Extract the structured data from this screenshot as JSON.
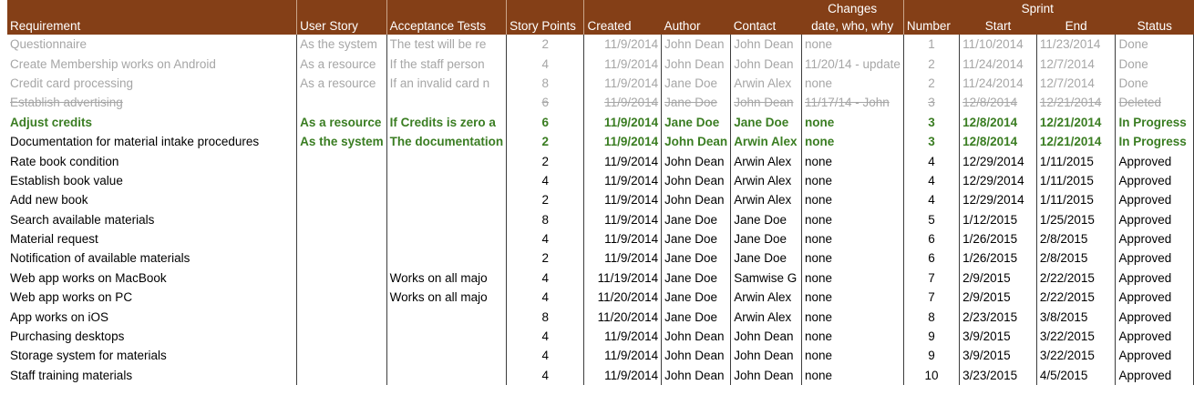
{
  "headers": {
    "requirement": "Requirement",
    "user_story": "User Story",
    "acceptance_tests": "Acceptance Tests",
    "story_points": "Story Points",
    "created": "Created",
    "author": "Author",
    "contact": "Contact",
    "changes_top": "Changes",
    "changes_bottom": "date, who, why",
    "sprint_group": "Sprint",
    "number": "Number",
    "start": "Start",
    "end": "End",
    "status": "Status"
  },
  "rows": [
    {
      "requirement": "Questionnaire",
      "user_story": "As the system",
      "acceptance_tests": "The test will be re",
      "points": "2",
      "created": "11/9/2014",
      "author": "John Dean",
      "contact": "John Dean",
      "changes": "none",
      "number": "1",
      "start": "11/10/2014",
      "end": "11/23/2014",
      "status": "Done",
      "state": "done"
    },
    {
      "requirement": "Create Membership works on Android",
      "user_story": "As a resource",
      "acceptance_tests": "If the staff person",
      "points": "4",
      "created": "11/9/2014",
      "author": "John Dean",
      "contact": "John Dean",
      "changes": "11/20/14 - update",
      "number": "2",
      "start": "11/24/2014",
      "end": "12/7/2014",
      "status": "Done",
      "state": "done"
    },
    {
      "requirement": "Credit card processing",
      "user_story": "As a resource",
      "acceptance_tests": "If an invalid card n",
      "points": "8",
      "created": "11/9/2014",
      "author": "Jane Doe",
      "contact": "Arwin Alex",
      "changes": "none",
      "number": "2",
      "start": "11/24/2014",
      "end": "12/7/2014",
      "status": "Done",
      "state": "done"
    },
    {
      "requirement": "Establish advertising",
      "user_story": "",
      "acceptance_tests": "",
      "points": "6",
      "created": "11/9/2014",
      "author": "Jane Doe",
      "contact": "John Dean",
      "changes": "11/17/14 - John",
      "number": "3",
      "start": "12/8/2014",
      "end": "12/21/2014",
      "status": "Deleted",
      "state": "deleted"
    },
    {
      "requirement": "Adjust credits",
      "user_story": "As a resource",
      "acceptance_tests": "If Credits is zero a",
      "points": "6",
      "created": "11/9/2014",
      "author": "Jane Doe",
      "contact": "Jane Doe",
      "changes": "none",
      "number": "3",
      "start": "12/8/2014",
      "end": "12/21/2014",
      "status": "In Progress",
      "state": "progress"
    },
    {
      "requirement": "Documentation for material intake procedures",
      "user_story": "As the system",
      "acceptance_tests": "The documentation",
      "points": "2",
      "created": "11/9/2014",
      "author": "John Dean",
      "contact": "Arwin Alex",
      "changes": "none",
      "number": "3",
      "start": "12/8/2014",
      "end": "12/21/2014",
      "status": "In Progress",
      "state": "progress2"
    },
    {
      "requirement": "Rate book condition",
      "user_story": "",
      "acceptance_tests": "",
      "points": "2",
      "created": "11/9/2014",
      "author": "John Dean",
      "contact": "Arwin Alex",
      "changes": "none",
      "number": "4",
      "start": "12/29/2014",
      "end": "1/11/2015",
      "status": "Approved",
      "state": "approved"
    },
    {
      "requirement": "Establish book value",
      "user_story": "",
      "acceptance_tests": "",
      "points": "4",
      "created": "11/9/2014",
      "author": "John Dean",
      "contact": "Arwin Alex",
      "changes": "none",
      "number": "4",
      "start": "12/29/2014",
      "end": "1/11/2015",
      "status": "Approved",
      "state": "approved"
    },
    {
      "requirement": "Add new book",
      "user_story": "",
      "acceptance_tests": "",
      "points": "2",
      "created": "11/9/2014",
      "author": "John Dean",
      "contact": "Arwin Alex",
      "changes": "none",
      "number": "4",
      "start": "12/29/2014",
      "end": "1/11/2015",
      "status": "Approved",
      "state": "approved"
    },
    {
      "requirement": "Search available materials",
      "user_story": "",
      "acceptance_tests": "",
      "points": "8",
      "created": "11/9/2014",
      "author": "Jane Doe",
      "contact": "Jane Doe",
      "changes": "none",
      "number": "5",
      "start": "1/12/2015",
      "end": "1/25/2015",
      "status": "Approved",
      "state": "approved"
    },
    {
      "requirement": "Material request",
      "user_story": "",
      "acceptance_tests": "",
      "points": "4",
      "created": "11/9/2014",
      "author": "Jane Doe",
      "contact": "Jane Doe",
      "changes": "none",
      "number": "6",
      "start": "1/26/2015",
      "end": "2/8/2015",
      "status": "Approved",
      "state": "approved"
    },
    {
      "requirement": "Notification of available materials",
      "user_story": "",
      "acceptance_tests": "",
      "points": "2",
      "created": "11/9/2014",
      "author": "Jane Doe",
      "contact": "Jane Doe",
      "changes": "none",
      "number": "6",
      "start": "1/26/2015",
      "end": "2/8/2015",
      "status": "Approved",
      "state": "approved"
    },
    {
      "requirement": "Web app works on MacBook",
      "user_story": "",
      "acceptance_tests": "Works on all majo",
      "points": "4",
      "created": "11/19/2014",
      "author": "Jane Doe",
      "contact": "Samwise G",
      "changes": "none",
      "number": "7",
      "start": "2/9/2015",
      "end": "2/22/2015",
      "status": "Approved",
      "state": "approved"
    },
    {
      "requirement": "Web app works on PC",
      "user_story": "",
      "acceptance_tests": "Works on all majo",
      "points": "4",
      "created": "11/20/2014",
      "author": "Jane Doe",
      "contact": "Arwin Alex",
      "changes": "none",
      "number": "7",
      "start": "2/9/2015",
      "end": "2/22/2015",
      "status": "Approved",
      "state": "approved"
    },
    {
      "requirement": "App works on iOS",
      "user_story": "",
      "acceptance_tests": "",
      "points": "8",
      "created": "11/20/2014",
      "author": "Jane Doe",
      "contact": "Arwin Alex",
      "changes": "none",
      "number": "8",
      "start": "2/23/2015",
      "end": "3/8/2015",
      "status": "Approved",
      "state": "approved"
    },
    {
      "requirement": "Purchasing desktops",
      "user_story": "",
      "acceptance_tests": "",
      "points": "4",
      "created": "11/9/2014",
      "author": "John Dean",
      "contact": "John Dean",
      "changes": "none",
      "number": "9",
      "start": "3/9/2015",
      "end": "3/22/2015",
      "status": "Approved",
      "state": "approved"
    },
    {
      "requirement": "Storage system for materials",
      "user_story": "",
      "acceptance_tests": "",
      "points": "4",
      "created": "11/9/2014",
      "author": "John Dean",
      "contact": "John Dean",
      "changes": "none",
      "number": "9",
      "start": "3/9/2015",
      "end": "3/22/2015",
      "status": "Approved",
      "state": "approved"
    },
    {
      "requirement": "Staff training materials",
      "user_story": "",
      "acceptance_tests": "",
      "points": "4",
      "created": "11/9/2014",
      "author": "John Dean",
      "contact": "John Dean",
      "changes": "none",
      "number": "10",
      "start": "3/23/2015",
      "end": "4/5/2015",
      "status": "Approved",
      "state": "approved"
    }
  ]
}
